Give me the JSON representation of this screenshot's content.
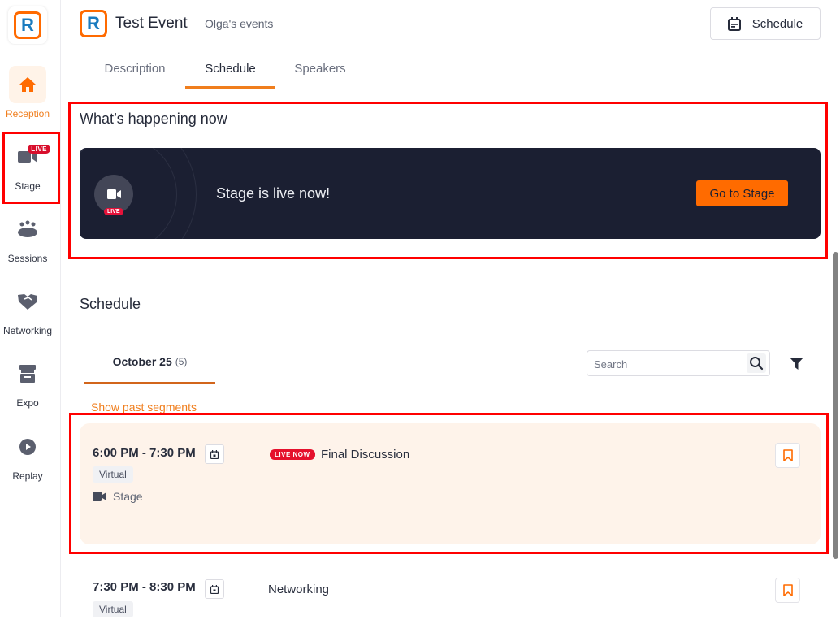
{
  "sidebar": {
    "logo_letter": "R",
    "items": [
      {
        "label": "Reception",
        "icon": "home-icon",
        "active": true
      },
      {
        "label": "Stage",
        "icon": "video-camera-icon",
        "badge": "LIVE"
      },
      {
        "label": "Sessions",
        "icon": "people-table-icon"
      },
      {
        "label": "Networking",
        "icon": "handshake-icon"
      },
      {
        "label": "Expo",
        "icon": "booth-icon"
      },
      {
        "label": "Replay",
        "icon": "play-circle-icon"
      }
    ]
  },
  "header": {
    "logo_letter": "R",
    "title": "Test Event",
    "organizer": "Olga's events",
    "schedule_button": "Schedule"
  },
  "tabs": [
    {
      "label": "Description",
      "active": false
    },
    {
      "label": "Schedule",
      "active": true
    },
    {
      "label": "Speakers",
      "active": false
    }
  ],
  "happening_now": {
    "title": "What’s happening now",
    "live_badge": "LIVE",
    "message": "Stage is live now!",
    "cta": "Go to Stage"
  },
  "schedule": {
    "title": "Schedule",
    "date_tab": {
      "date": "October 25",
      "count": "(5)"
    },
    "search_placeholder": "Search",
    "past_link": "Show past segments",
    "segments": [
      {
        "time": "6:00 PM - 7:30 PM",
        "tag": "Virtual",
        "location": "Stage",
        "status": "LIVE NOW",
        "title": "Final Discussion",
        "live": true
      },
      {
        "time": "7:30 PM - 8:30 PM",
        "tag": "Virtual",
        "title": "Networking",
        "live": false
      }
    ]
  },
  "colors": {
    "accent": "#ff6b00",
    "live_red": "#e5102c",
    "dark_card": "#1b1f32",
    "live_segment_bg": "#fef3ea"
  }
}
